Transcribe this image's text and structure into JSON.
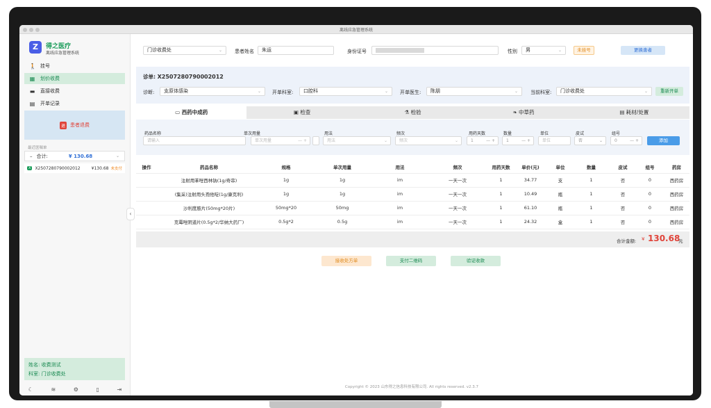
{
  "window": {
    "title": "离线应急管理系统"
  },
  "brand": {
    "name": "得之医疗",
    "subtitle": "离线应急管理系统",
    "logo_glyph": "Z"
  },
  "nav": [
    {
      "label": "挂号",
      "icon": "walk-icon"
    },
    {
      "label": "划价收费",
      "icon": "calculator-icon"
    },
    {
      "label": "直接收费",
      "icon": "card-icon"
    },
    {
      "label": "开单记录",
      "icon": "document-icon"
    }
  ],
  "urgent": {
    "label": "患者退费",
    "icon_text": "退"
  },
  "recent": {
    "label": "最近医嘱单",
    "total_label": "合计:",
    "total_value": "¥ 130.68",
    "order_no": "X2507280790002012",
    "order_amount": "¥130.68",
    "order_status": "未支付"
  },
  "user": {
    "name_label": "姓名:",
    "name": "收费测试",
    "dept_label": "科室:",
    "dept": "门诊收费处"
  },
  "patient": {
    "dept_select": "门诊收费处",
    "name_label": "患者姓名",
    "name_value": "朱运",
    "id_label": "身份证号",
    "gender_label": "性别",
    "gender_value": "男",
    "reg_badge": "未挂号",
    "change_button": "更换患者"
  },
  "order": {
    "label": "诊单:",
    "number": "X2507280790002012",
    "diag_label": "诊断:",
    "diag_value": "支原体感染",
    "dept_label": "开单科室:",
    "dept_value": "口腔科",
    "doctor_label": "开单医生:",
    "doctor_value": "陈朋",
    "cur_dept_label": "当前科室:",
    "cur_dept_value": "门诊收费处",
    "reopen_button": "重新开单"
  },
  "tabs": [
    {
      "label": "西药中成药",
      "icon": "pill-icon",
      "active": true
    },
    {
      "label": "检查",
      "icon": "box-icon",
      "active": false
    },
    {
      "label": "检验",
      "icon": "microscope-icon",
      "active": false
    },
    {
      "label": "中草药",
      "icon": "leaf-icon",
      "active": false
    },
    {
      "label": "耗材/处置",
      "icon": "kit-icon",
      "active": false
    }
  ],
  "form": {
    "headers": [
      "药品名称",
      "单次用量",
      "用法",
      "频次",
      "用药天数",
      "数量",
      "单位",
      "皮试",
      "组号"
    ],
    "drug_placeholder": "请输入",
    "dose_placeholder": "单次用量",
    "usage_placeholder": "用法",
    "freq_placeholder": "频次",
    "days_value": "1",
    "qty_value": "1",
    "unit_placeholder": "单位",
    "skin_value": "否",
    "group_value": "0",
    "add_button": "添加"
  },
  "table": {
    "headers": [
      "操作",
      "药品名称",
      "规格",
      "单次用量",
      "用法",
      "频次",
      "用药天数",
      "单价(元)",
      "单位",
      "数量",
      "皮试",
      "组号",
      "药房"
    ],
    "rows": [
      [
        "",
        "注射用苯唑西林钠(1g/奇菲)",
        "1g",
        "1g",
        "im",
        "一天一次",
        "1",
        "34.77",
        "支",
        "1",
        "否",
        "0",
        "西药房"
      ],
      [
        "",
        "(集采)注射用头孢他啶(1g/康克利)",
        "1g",
        "1g",
        "im",
        "一天一次",
        "1",
        "10.49",
        "瓶",
        "1",
        "否",
        "0",
        "西药房"
      ],
      [
        "",
        "沙利度胺片(50mg*20片)",
        "50mg*20",
        "50mg",
        "im",
        "一天一次",
        "1",
        "61.10",
        "瓶",
        "1",
        "否",
        "0",
        "西药房"
      ],
      [
        "",
        "克霉唑阴道片(0.5g*2/华纳大药厂)",
        "0.5g*2",
        "0.5g",
        "im",
        "一天一次",
        "1",
        "24.32",
        "盒",
        "1",
        "否",
        "0",
        "西药房"
      ]
    ]
  },
  "summary": {
    "label": "合计金额:",
    "currency": "¥",
    "amount": "130.68",
    "unit": "元"
  },
  "actions": {
    "receive": "接收处方单",
    "qrcode": "支付二维码",
    "verify": "验证收款"
  },
  "footer": "Copyright © 2023 山东得之信息科技有限公司. All rights reserved. v2.3.7",
  "colors": {
    "accent": "#1a9c5a",
    "primary": "#4a5ee6",
    "danger": "#e0443a"
  }
}
